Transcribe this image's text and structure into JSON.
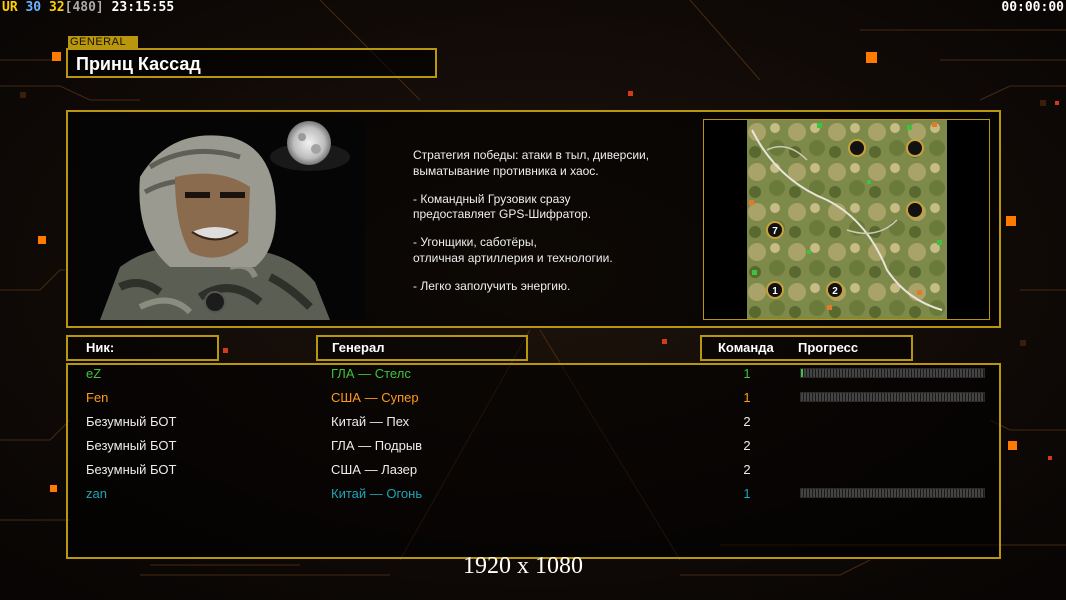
{
  "hud": {
    "ur_label": "UR",
    "fps1": "30",
    "fps2": "32",
    "ping": "[480]",
    "clock": "23:15:55",
    "timer": "00:00:00"
  },
  "general": {
    "tag": "GENERAL",
    "name": "Принц Кассад"
  },
  "description": [
    "Стратегия победы: атаки в тыл, диверсии,\n выматывание противника и хаос.",
    "- Командный Грузовик сразу\nпредоставляет GPS-Шифратор.",
    "- Угонщики, саботёры,\nотличная артиллерия и технологии.",
    "- Легко заполучить энергию."
  ],
  "map": {
    "markers": [
      "7",
      "1",
      "2"
    ]
  },
  "headers": {
    "nick": "Ник:",
    "general": "Генерал",
    "team": "Команда",
    "progress": "Прогресс"
  },
  "players": [
    {
      "nick": "eZ",
      "general": "ГЛА — Стелс",
      "team": "1",
      "color": "#3ec33e",
      "progress": 0.01,
      "show_progress": true
    },
    {
      "nick": "Fen",
      "general": "США — Супер",
      "team": "1",
      "color": "#ff9a1f",
      "progress": 0.0,
      "show_progress": true
    },
    {
      "nick": "Безумный БОТ",
      "general": "Китай — Пех",
      "team": "2",
      "color": "#ececec",
      "progress": 0.0,
      "show_progress": false
    },
    {
      "nick": "Безумный БОТ",
      "general": "ГЛА — Подрыв",
      "team": "2",
      "color": "#ececec",
      "progress": 0.0,
      "show_progress": false
    },
    {
      "nick": "Безумный БОТ",
      "general": "США — Лазер",
      "team": "2",
      "color": "#ececec",
      "progress": 0.0,
      "show_progress": false
    },
    {
      "nick": "zan",
      "general": "Китай — Огонь",
      "team": "1",
      "color": "#1fa5b5",
      "progress": 0.0,
      "show_progress": true
    }
  ],
  "resolution": "1920 x 1080"
}
